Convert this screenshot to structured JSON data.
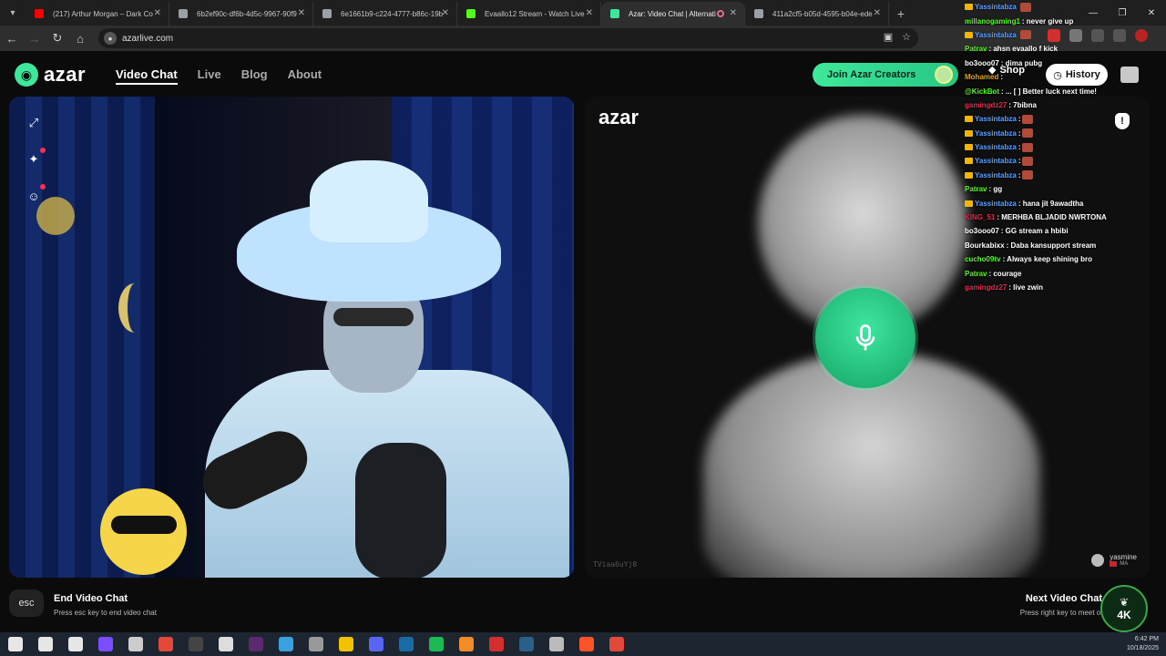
{
  "browser": {
    "tabs": [
      {
        "title": "(217) Arthur Morgan – Dark Co",
        "favicon_color": "#ff0000",
        "active": false
      },
      {
        "title": "6b2ef90c-df6b-4d5c-9967-90f9",
        "favicon_color": "#9aa0a6",
        "active": false
      },
      {
        "title": "6e1661b9-c224-4777-b86c-19b",
        "favicon_color": "#9aa0a6",
        "active": false
      },
      {
        "title": "Evaallo12 Stream - Watch Live",
        "favicon_color": "#53fc18",
        "active": false
      },
      {
        "title": "Azar: Video Chat | Alternati",
        "favicon_color": "#3ee89a",
        "active": true
      },
      {
        "title": "411a2cf5-b05d-4595-b04e-ede",
        "favicon_color": "#9aa0a6",
        "active": false
      }
    ],
    "new_tab_label": "+",
    "url": "azarlive.com"
  },
  "azar": {
    "logo_text": "azar",
    "nav": [
      "Video Chat",
      "Live",
      "Blog",
      "About"
    ],
    "creators_button": "Join Azar Creators",
    "shop_label": "Shop",
    "history_label": "History",
    "right_logo": "azar",
    "room_id": "TViaa6uYj8",
    "partner": {
      "name": "yasmine",
      "country": "MA"
    },
    "end_chat": {
      "title": "End Video Chat",
      "subtitle": "Press esc key to end video chat",
      "key": "esc"
    },
    "next_chat": {
      "title": "Next Video Chat",
      "subtitle": "Press right key to meet other"
    }
  },
  "chat_messages": [
    {
      "user": "Yassintabza",
      "text": "",
      "color": "#5aa0ff",
      "badge": true,
      "emote": true
    },
    {
      "user": "millanogaming1",
      "text": ": never give up",
      "color": "#53fc18",
      "badge": false,
      "emote": false
    },
    {
      "user": "Yassintabza",
      "text": "",
      "color": "#5aa0ff",
      "badge": true,
      "emote": true
    },
    {
      "user": "Patrav",
      "text": ": ahsn evaallo f kick",
      "color": "#53fc18",
      "badge": false,
      "emote": false
    },
    {
      "user": "bo3ooo07",
      "text": ": dima pubg",
      "color": "#ffffff",
      "badge": false,
      "emote": false
    },
    {
      "user": "Mohamed",
      "text": ": ",
      "color": "#d9a400",
      "badge": false,
      "emote": false
    },
    {
      "user": "@KickBot",
      "text": ": ... [ ] Better luck next time!",
      "color": "#53fc18",
      "badge": false,
      "emote": false
    },
    {
      "user": "gamingdz27",
      "text": ": 7bibna",
      "color": "#e0284f",
      "badge": false,
      "emote": false
    },
    {
      "user": "Yassintabza",
      "text": ":",
      "color": "#5aa0ff",
      "badge": true,
      "emote": true
    },
    {
      "user": "Yassintabza",
      "text": ":",
      "color": "#5aa0ff",
      "badge": true,
      "emote": true
    },
    {
      "user": "Yassintabza",
      "text": ":",
      "color": "#5aa0ff",
      "badge": true,
      "emote": true
    },
    {
      "user": "Yassintabza",
      "text": ":",
      "color": "#5aa0ff",
      "badge": true,
      "emote": true
    },
    {
      "user": "Yassintabza",
      "text": ":",
      "color": "#5aa0ff",
      "badge": true,
      "emote": true
    },
    {
      "user": "Patrav",
      "text": ": gg",
      "color": "#53fc18",
      "badge": false,
      "emote": false
    },
    {
      "user": "Yassintabza",
      "text": ": hana jit 9awadtha",
      "color": "#5aa0ff",
      "badge": true,
      "emote": false
    },
    {
      "user": "KING_51",
      "text": ": MERHBA BLJADID NWRTONA",
      "color": "#e0284f",
      "badge": false,
      "emote": false
    },
    {
      "user": "bo3ooo07",
      "text": ": GG stream a hbibi",
      "color": "#ffffff",
      "badge": false,
      "emote": false
    },
    {
      "user": "Bourkabixx",
      "text": ": Daba kansupport stream",
      "color": "#ffffff",
      "badge": false,
      "emote": false
    },
    {
      "user": "cucho09tv",
      "text": ": Always keep shining bro",
      "color": "#53fc18",
      "badge": false,
      "emote": false
    },
    {
      "user": "Patrav",
      "text": ": courage",
      "color": "#53fc18",
      "badge": false,
      "emote": false
    },
    {
      "user": "gamingdz27",
      "text": ": live zwin",
      "color": "#e0284f",
      "badge": false,
      "emote": false
    }
  ],
  "watermark_text": "4K",
  "taskbar": {
    "time": "6:42 PM",
    "date": "10/18/2025",
    "apps": [
      {
        "name": "windows-start-icon",
        "color": "#e6e6e6"
      },
      {
        "name": "search-icon",
        "color": "#e6e6e6"
      },
      {
        "name": "task-view-icon",
        "color": "#e6e6e6"
      },
      {
        "name": "app-purple-icon",
        "color": "#7a4dff"
      },
      {
        "name": "app-dark-icon",
        "color": "#cccccc"
      },
      {
        "name": "chrome-icon",
        "color": "#e2493b"
      },
      {
        "name": "obs-icon",
        "color": "#444444"
      },
      {
        "name": "app-cat-icon",
        "color": "#dddddd"
      },
      {
        "name": "app-v-icon",
        "color": "#5b2a6e"
      },
      {
        "name": "app-window-icon",
        "color": "#3ba0e0"
      },
      {
        "name": "app-person-icon",
        "color": "#999999"
      },
      {
        "name": "folder-icon",
        "color": "#f2c200"
      },
      {
        "name": "discord-icon",
        "color": "#5865f2"
      },
      {
        "name": "steam-icon",
        "color": "#1b6aa3"
      },
      {
        "name": "spotify-icon",
        "color": "#1db954"
      },
      {
        "name": "app-a-icon",
        "color": "#f28c28"
      },
      {
        "name": "app-red-icon",
        "color": "#d32f2f"
      },
      {
        "name": "steam-small-icon",
        "color": "#2a5f8a"
      },
      {
        "name": "settings-icon",
        "color": "#bbbbbb"
      },
      {
        "name": "brave-icon",
        "color": "#fb542b"
      },
      {
        "name": "chrome2-icon",
        "color": "#e2493b"
      }
    ]
  }
}
